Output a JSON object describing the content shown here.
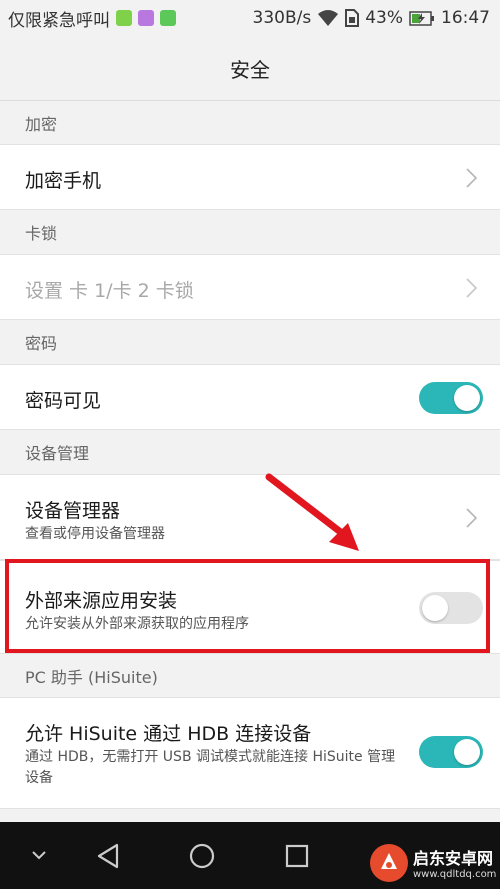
{
  "status_bar": {
    "carrier_text": "仅限紧急呼叫",
    "speed": "330B/s",
    "battery_percent": "43%",
    "time": "16:47",
    "app_badge_colors": [
      "#7fd14a",
      "#b978e0",
      "#5cc85a"
    ],
    "icons": [
      "wifi-icon",
      "sim-icon",
      "battery-charging-icon"
    ]
  },
  "header": {
    "title": "安全"
  },
  "sections": {
    "encryption": {
      "label": "加密"
    },
    "card_lock": {
      "label": "卡锁"
    },
    "password": {
      "label": "密码"
    },
    "device_management": {
      "label": "设备管理"
    },
    "pc_assistant": {
      "label": "PC 助手 (HiSuite)"
    }
  },
  "items": {
    "encrypt_phone": {
      "title": "加密手机"
    },
    "sim_lock": {
      "title": "设置 卡 1/卡 2 卡锁",
      "enabled": false
    },
    "password_visible": {
      "title": "密码可见",
      "toggle": "on"
    },
    "device_admin": {
      "title": "设备管理器",
      "subtitle": "查看或停用设备管理器"
    },
    "unknown_sources": {
      "title": "外部来源应用安装",
      "subtitle": "允许安装从外部来源获取的应用程序",
      "toggle": "off"
    },
    "hisuite_hdb": {
      "title": "允许 HiSuite 通过 HDB 连接设备",
      "subtitle": "通过 HDB，无需打开 USB 调试模式就能连接 HiSuite 管理设备",
      "toggle": "on"
    }
  },
  "colors": {
    "accent": "#2bb6b7",
    "annotation_red": "#e2161f",
    "navbar": "#111111"
  },
  "navbar": {
    "icons": [
      "chevron-down-icon",
      "back-icon",
      "home-icon",
      "recents-icon"
    ]
  },
  "watermark": {
    "name": "启东安卓网",
    "url": "www.qdltdq.com"
  }
}
